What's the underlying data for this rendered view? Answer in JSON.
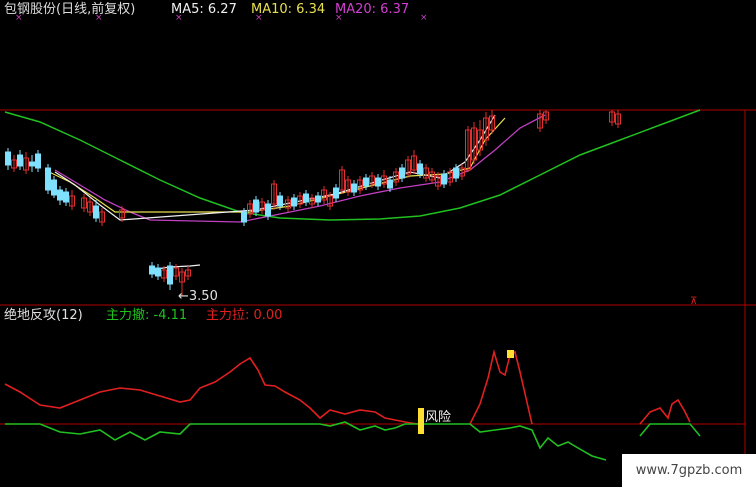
{
  "colors": {
    "background": "#000000",
    "frame": "#b00000",
    "up_candle": "#e03030",
    "down_candle": "#7fe0ff",
    "ma5": "#f0f0f0",
    "ma10": "#e8e050",
    "ma20": "#c040c0",
    "long_ma": "#20c020",
    "zhuli_che": "#20c020",
    "zhuli_la": "#e02020",
    "marker": "#ffe030"
  },
  "header": {
    "stock_title": "包钢股份(日线,前复权)",
    "ma5_label": "MA5: 6.27",
    "ma10_label": "MA10: 6.34",
    "ma20_label": "MA20: 6.37"
  },
  "indicator_header": {
    "name": "绝地反攻(12)",
    "che_label": "主力撤: -4.11",
    "la_label": "主力拉: 0.00"
  },
  "annotations": {
    "low_price": "←3.50",
    "risk": "风险"
  },
  "watermark": "www.7gpzb.com",
  "chart_data": {
    "type": "line",
    "panels": [
      {
        "name": "price",
        "series": [
          {
            "name": "MA5",
            "values": [
              6.27
            ]
          },
          {
            "name": "MA10",
            "values": [
              6.34
            ]
          },
          {
            "name": "MA20",
            "values": [
              6.37
            ]
          }
        ],
        "low_marker": 3.5
      },
      {
        "name": "绝地反攻(12)",
        "series": [
          {
            "name": "主力撤",
            "current": -4.11
          },
          {
            "name": "主力拉",
            "current": 0.0
          }
        ]
      }
    ]
  }
}
